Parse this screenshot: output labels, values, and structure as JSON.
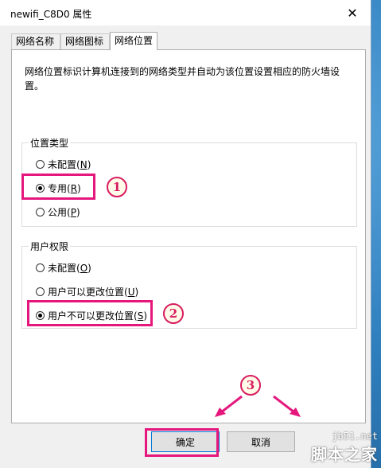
{
  "window": {
    "title": "newifi_C8D0 属性"
  },
  "tabs": [
    {
      "label": "网络名称"
    },
    {
      "label": "网络图标"
    },
    {
      "label": "网络位置",
      "active": true
    }
  ],
  "description": "网络位置标识计算机连接到的网络类型并自动为该位置设置相应的防火墙设置。",
  "location_group": {
    "legend": "位置类型",
    "options": [
      {
        "label": "未配置",
        "key": "N",
        "selected": false
      },
      {
        "label": "专用",
        "key": "R",
        "selected": true
      },
      {
        "label": "公用",
        "key": "P",
        "selected": false
      }
    ]
  },
  "permission_group": {
    "legend": "用户权限",
    "options": [
      {
        "label": "未配置",
        "key": "O",
        "selected": false
      },
      {
        "label": "用户可以更改位置",
        "key": "U",
        "selected": false
      },
      {
        "label": "用户不可以更改位置",
        "key": "S",
        "selected": true
      }
    ]
  },
  "buttons": {
    "ok": "确定",
    "cancel": "取消"
  },
  "annotations": {
    "one": "1",
    "two": "2",
    "three": "3"
  },
  "watermark": {
    "url": "jb51.net",
    "text": "脚本之家"
  },
  "colors": {
    "highlight": "#e5177d",
    "desktop": "#2f7fbe"
  }
}
